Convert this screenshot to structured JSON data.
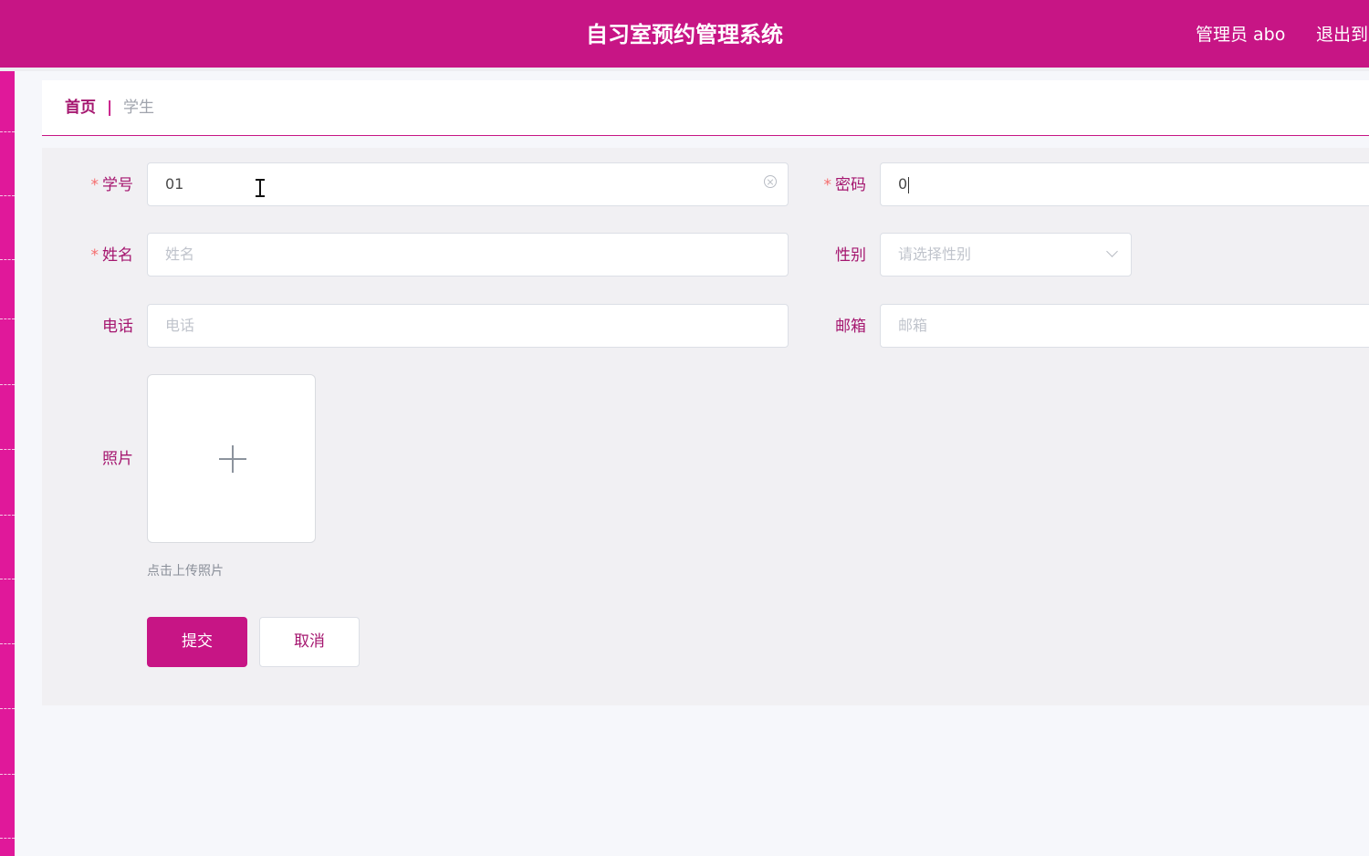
{
  "header": {
    "title": "自习室预约管理系统",
    "user_label": "管理员 abo",
    "logout_label": "退出到"
  },
  "breadcrumb": {
    "home": "首页",
    "separator": "|",
    "current": "学生"
  },
  "form": {
    "required_mark": "*",
    "student_id": {
      "label": "学号",
      "value": "01"
    },
    "password": {
      "label": "密码",
      "value": "0"
    },
    "name": {
      "label": "姓名",
      "placeholder": "姓名"
    },
    "gender": {
      "label": "性别",
      "placeholder": "请选择性别"
    },
    "phone": {
      "label": "电话",
      "placeholder": "电话"
    },
    "email": {
      "label": "邮箱",
      "placeholder": "邮箱"
    },
    "photo": {
      "label": "照片",
      "hint": "点击上传照片"
    },
    "submit_label": "提交",
    "cancel_label": "取消"
  },
  "colors": {
    "brand": "#c71585",
    "label_text": "#a5166f",
    "required": "#f56c6c",
    "panel_bg": "#f1f0f3"
  },
  "icons": [
    "clear-icon",
    "chevron-down-icon",
    "plus-icon",
    "text-cursor-icon"
  ]
}
